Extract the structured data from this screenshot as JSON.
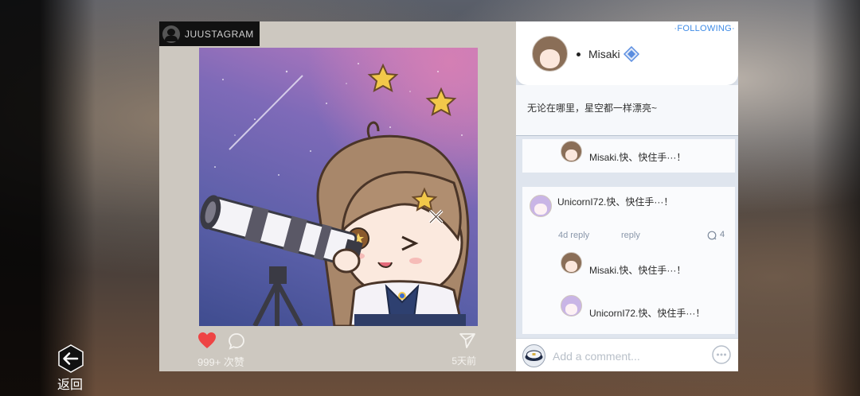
{
  "post": {
    "app_name": "JUUSTAGRAM",
    "likes": "999+ 次赞",
    "time_ago": "5天前"
  },
  "panel": {
    "following_label": "·FOLLOWING·",
    "author": "Misaki",
    "caption": "无论在哪里，星空都一样漂亮~",
    "comments": [
      {
        "name": "Misaki",
        "text": ".快、快住手···！"
      },
      {
        "name": "UnicornI72",
        "text": ".快、快住手···！",
        "age": "4d reply",
        "reply_label": "reply",
        "reply_count": "4"
      },
      {
        "name": "Misaki",
        "text": ".快、快住手···！"
      },
      {
        "name": "UnicornI72",
        "text": ".快、快住手···！"
      }
    ],
    "comment_placeholder": "Add a comment..."
  },
  "nav": {
    "back_label": "返回"
  },
  "colors": {
    "following": "#3e8be6",
    "like": "#ee4444",
    "verified": "#5a8de0"
  }
}
